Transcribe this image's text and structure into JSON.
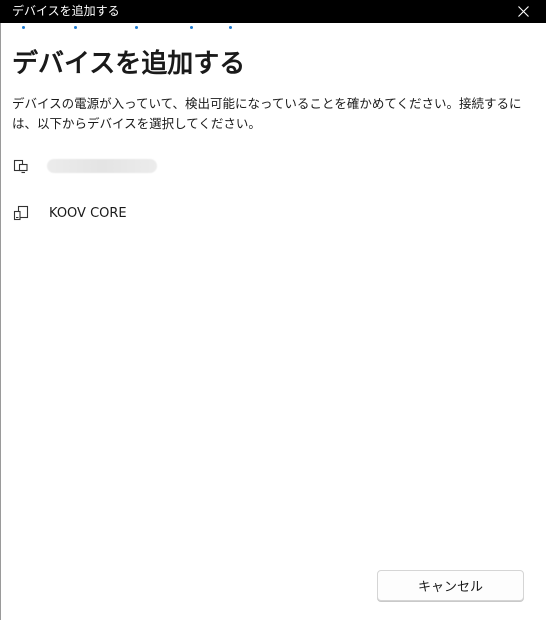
{
  "window": {
    "title": "デバイスを追加する",
    "close_icon": "close-icon"
  },
  "progress": {
    "indeterminate": true,
    "color": "#1e7ad1"
  },
  "main": {
    "heading": "デバイスを追加する",
    "description": "デバイスの電源が入っていて、検出可能になっていることを確かめてください。接続するには、以下からデバイスを選択してください。"
  },
  "devices": [
    {
      "icon": "device-icon",
      "name": ""
    },
    {
      "icon": "device-icon",
      "name": "KOOV CORE"
    }
  ],
  "footer": {
    "cancel_label": "キャンセル"
  }
}
